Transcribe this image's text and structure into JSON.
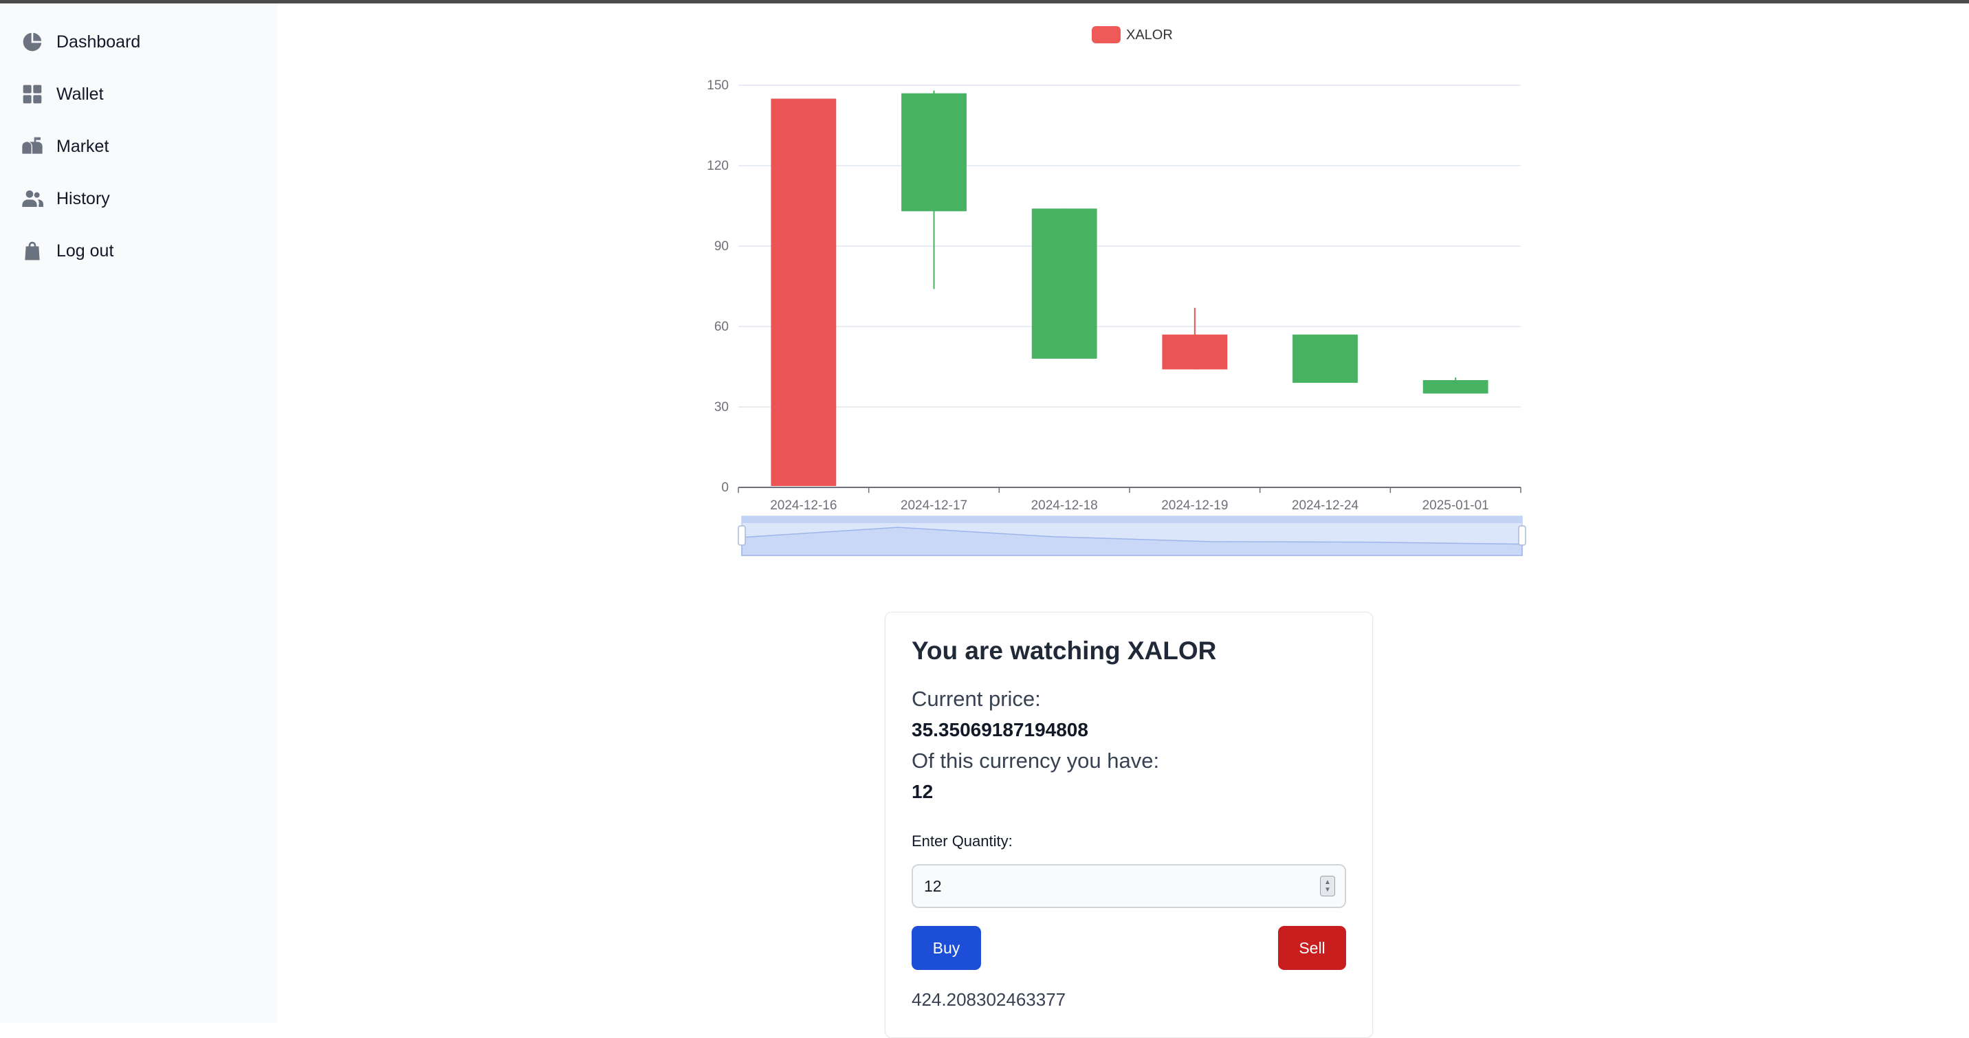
{
  "sidebar": {
    "items": [
      {
        "label": "Dashboard",
        "icon": "pie-chart-icon"
      },
      {
        "label": "Wallet",
        "icon": "grid-icon"
      },
      {
        "label": "Market",
        "icon": "mailbox-icon"
      },
      {
        "label": "History",
        "icon": "users-icon"
      },
      {
        "label": "Log out",
        "icon": "shopping-bag-icon"
      }
    ]
  },
  "chart_data": {
    "type": "candlestick",
    "legend": [
      "XALOR"
    ],
    "legend_color": "#ee5a58",
    "categories": [
      "2024-12-16",
      "2024-12-17",
      "2024-12-18",
      "2024-12-19",
      "2024-12-24",
      "2025-01-01"
    ],
    "y_ticks": [
      "0",
      "30",
      "60",
      "90",
      "120",
      "150"
    ],
    "ylim": [
      0,
      150
    ],
    "up_color": "#47b262",
    "down_color": "#eb5454",
    "candles": [
      {
        "open": 145,
        "close": 0.5,
        "low": 0.5,
        "high": 145
      },
      {
        "open": 103,
        "close": 147,
        "low": 74,
        "high": 148
      },
      {
        "open": 48,
        "close": 104,
        "low": 48,
        "high": 104
      },
      {
        "open": 57,
        "close": 44,
        "low": 44,
        "high": 67
      },
      {
        "open": 39,
        "close": 57,
        "low": 39,
        "high": 57
      },
      {
        "open": 35,
        "close": 40,
        "low": 35,
        "high": 41
      }
    ],
    "zoom_range": [
      0,
      1
    ],
    "grid": true
  },
  "card": {
    "title": "You are watching XALOR",
    "current_price_label": "Current price:",
    "current_price": "35.35069187194808",
    "holding_label": "Of this currency you have:",
    "holding": "12",
    "quantity_label": "Enter Quantity:",
    "quantity_value": "12",
    "buy_label": "Buy",
    "sell_label": "Sell",
    "total": "424.208302463377"
  }
}
